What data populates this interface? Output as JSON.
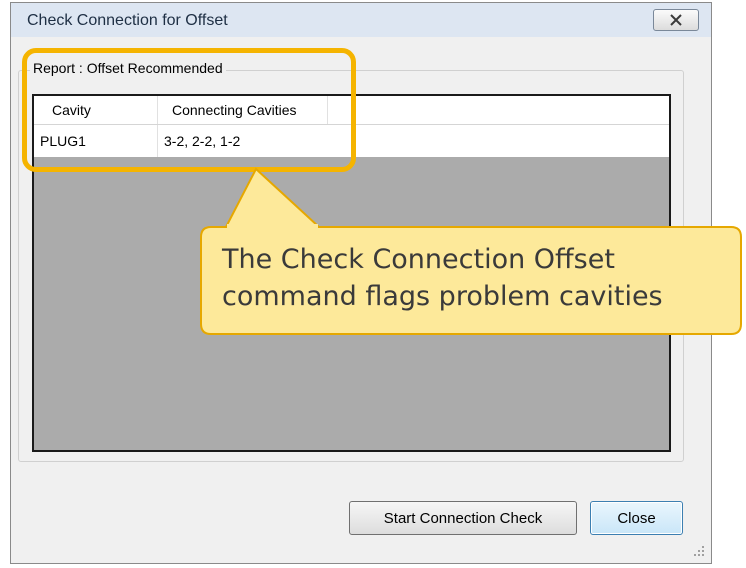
{
  "window": {
    "title": "Check Connection for Offset"
  },
  "group": {
    "label": "Report : Offset Recommended"
  },
  "table": {
    "columns": [
      "Cavity",
      "Connecting Cavities"
    ],
    "rows": [
      {
        "cavity": "PLUG1",
        "connecting": "3-2, 2-2, 1-2"
      }
    ]
  },
  "buttons": {
    "start": "Start Connection Check",
    "close": "Close"
  },
  "callout": {
    "text": "The Check Connection Offset command flags problem cavities"
  },
  "colors": {
    "highlight": "#f5b400",
    "callout_fill": "#fde99a"
  },
  "icons": {
    "close": "close-x-icon",
    "grip": "resize-grip-icon"
  }
}
